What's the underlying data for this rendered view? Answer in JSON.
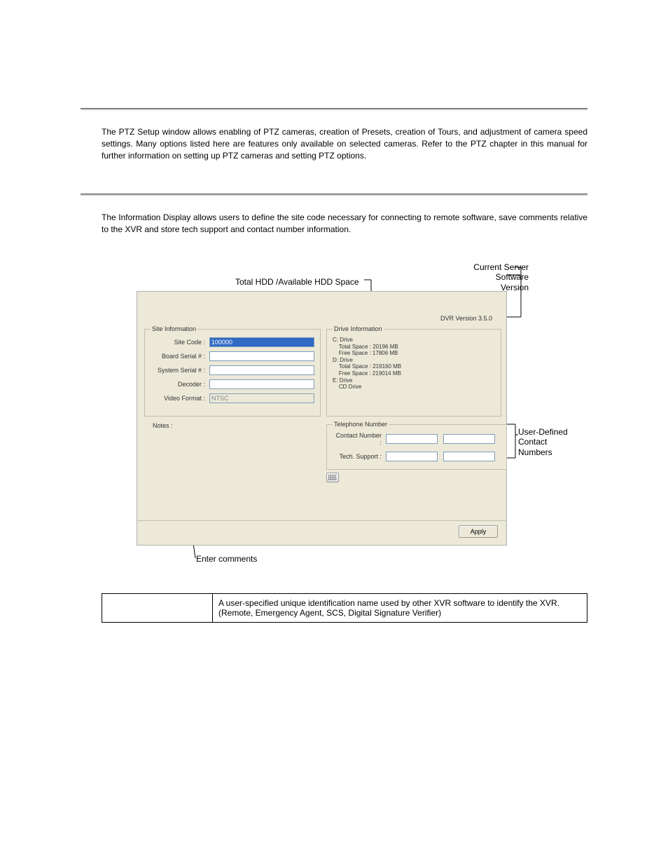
{
  "paragraphs": {
    "ptz": "The PTZ Setup window allows enabling of PTZ cameras, creation of Presets, creation of Tours, and adjustment of camera speed settings. Many options listed here are features only available on selected cameras. Refer to the PTZ chapter in this manual for further information on setting up PTZ cameras and setting PTZ options.",
    "info_display": "The Information Display allows users to define the site code necessary for connecting to remote software, save comments relative to the XVR and store tech support and contact number information."
  },
  "callouts": {
    "hdd": "Total HDD /Available HDD Space",
    "version_line1": "Current Server",
    "version_line2": "Software Version",
    "contacts_line1": "User-Defined",
    "contacts_line2": "Contact Numbers",
    "comments": "Enter comments"
  },
  "window": {
    "dvr_version": "DVR Version 3.5.0",
    "site_info": {
      "legend": "Site Information",
      "site_code_label": "Site Code :",
      "site_code_value": "100000",
      "board_serial_label": "Board Serial # :",
      "board_serial_value": "",
      "system_serial_label": "System Serial # :",
      "system_serial_value": "",
      "decoder_label": "Decoder :",
      "decoder_value": "",
      "video_format_label": "Video Format :",
      "video_format_value": "NTSC"
    },
    "drive_info": {
      "legend": "Drive Information",
      "text": "C: Drive\n    Total Space : 20196 MB\n    Free Space : 17806 MB\nD: Drive\n    Total Space : 219160 MB\n    Free Space : 219014 MB\nE: Drive\n    CD Drive"
    },
    "notes_label": "Notes :",
    "telephone": {
      "legend": "Telephone Number",
      "contact_label": "Contact Number :",
      "tech_label": "Tech. Support :"
    },
    "apply_label": "Apply"
  },
  "table": {
    "row1_desc": "A user-specified unique identification name used by other XVR software to identify the XVR. (Remote, Emergency Agent, SCS, Digital Signature Verifier)"
  }
}
